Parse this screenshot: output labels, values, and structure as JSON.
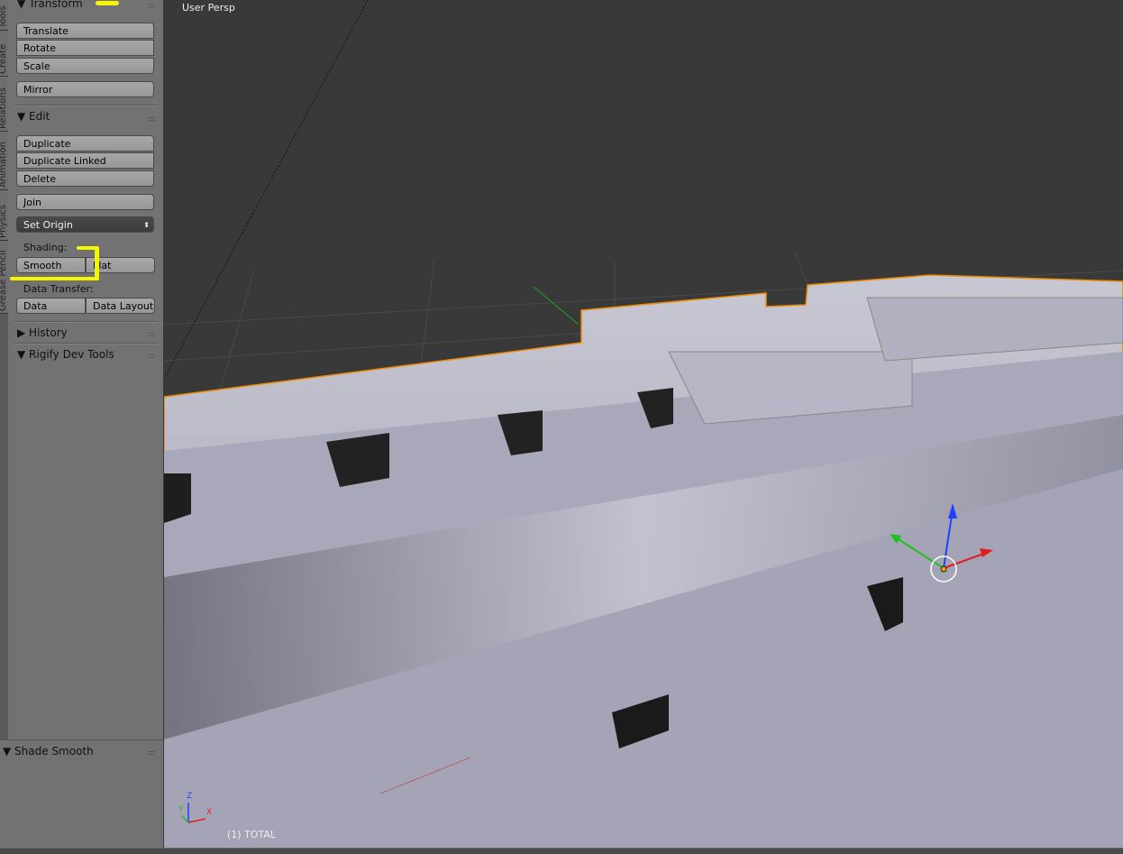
{
  "side_tabs": [
    "Tools",
    "Create",
    "Relations",
    "Animation",
    "Physics",
    "Grease Pencil"
  ],
  "panel": {
    "transform": {
      "title": "Transform",
      "buttons": [
        "Translate",
        "Rotate",
        "Scale"
      ],
      "mirror": "Mirror"
    },
    "edit": {
      "title": "Edit",
      "buttons": [
        "Duplicate",
        "Duplicate Linked",
        "Delete"
      ],
      "join": "Join",
      "set_origin": "Set Origin",
      "shading_label": "Shading:",
      "smooth": "Smooth",
      "flat": "Flat",
      "data_transfer_label": "Data Transfer:",
      "data": "Data",
      "data_layout": "Data Layout"
    },
    "history": {
      "title": "History"
    },
    "rigify": {
      "title": "Rigify Dev Tools"
    },
    "operator": {
      "title": "Shade Smooth"
    }
  },
  "viewport": {
    "view_name": "User Persp",
    "object_info": "(1) TOTAL",
    "axis_labels": {
      "x": "X",
      "y": "Y",
      "z": "Z"
    }
  },
  "colors": {
    "selection_outline": "#f08a00",
    "annotation": "#f5f500",
    "x_axis": "#e02020",
    "y_axis": "#20c020",
    "z_axis": "#2040ff"
  }
}
